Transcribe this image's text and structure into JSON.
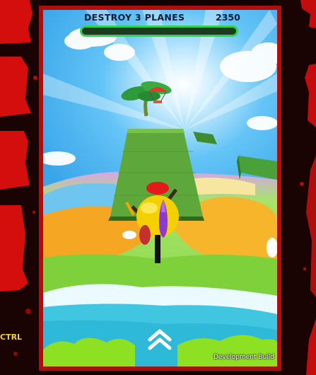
{
  "hud": {
    "objective": "DESTROY 3 PLANES",
    "score": "2350",
    "progress": 0.0
  },
  "controls": {
    "up_icon": "double-chevron-up-icon",
    "ctrl_hint": "CTRL"
  },
  "footer": {
    "build_label": "Development Build"
  },
  "colors": {
    "sky": "#4ab3f0",
    "frame": "#b00d0d",
    "progress_fill": "#34d14a",
    "ball": "#f5d000"
  }
}
